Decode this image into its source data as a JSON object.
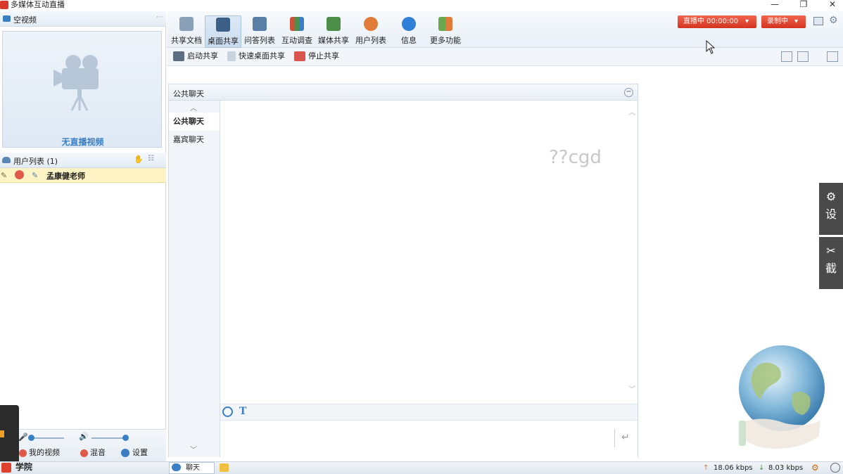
{
  "window": {
    "title": "多媒体互动直播",
    "controls": [
      "—",
      "❐",
      "✕"
    ]
  },
  "left": {
    "video_header": "空视频",
    "no_video_text": "无直播视频",
    "user_list_header": "用户列表 (1)",
    "users": [
      {
        "name": "孟康健老师"
      }
    ],
    "bottom": {
      "my_video": "我的视频",
      "mix": "混音",
      "settings": "设置"
    },
    "overlay_logo_text": "学院"
  },
  "toolbar": {
    "buttons": [
      {
        "label": "共享文档",
        "icon": "document-icon",
        "color": "#8aa0b8"
      },
      {
        "label": "桌面共享",
        "icon": "desktop-share-icon",
        "color": "#3b5f86"
      },
      {
        "label": "问答列表",
        "icon": "qa-list-icon",
        "color": "#5a7fa6"
      },
      {
        "label": "互动调查",
        "icon": "survey-chart-icon",
        "color": "#d1503a"
      },
      {
        "label": "媒体共享",
        "icon": "media-share-icon",
        "color": "#4d8f4a"
      },
      {
        "label": "用户列表",
        "icon": "users-icon",
        "color": "#e07b39"
      },
      {
        "label": "信息",
        "icon": "info-icon",
        "color": "#2f7fd8"
      },
      {
        "label": "更多功能",
        "icon": "more-apps-icon",
        "color": "#6aa84f"
      }
    ],
    "live_status": "直播中 00:00:00",
    "record_status": "录制中"
  },
  "subbar": {
    "start": "启动共享",
    "quick": "快速桌面共享",
    "stop": "停止共享"
  },
  "chat": {
    "header": "公共聊天",
    "tabs": [
      {
        "label": "公共聊天",
        "active": true
      },
      {
        "label": "嘉宾聊天",
        "active": false
      }
    ],
    "watermark": "??cgd"
  },
  "side_tabs": [
    "设",
    "截"
  ],
  "status": {
    "chat_tab": "聊天",
    "upload": "18.06 kbps",
    "download": "8.03 kbps"
  },
  "colors": {
    "accent": "#3a7ec4",
    "live_red": "#e0412c"
  }
}
